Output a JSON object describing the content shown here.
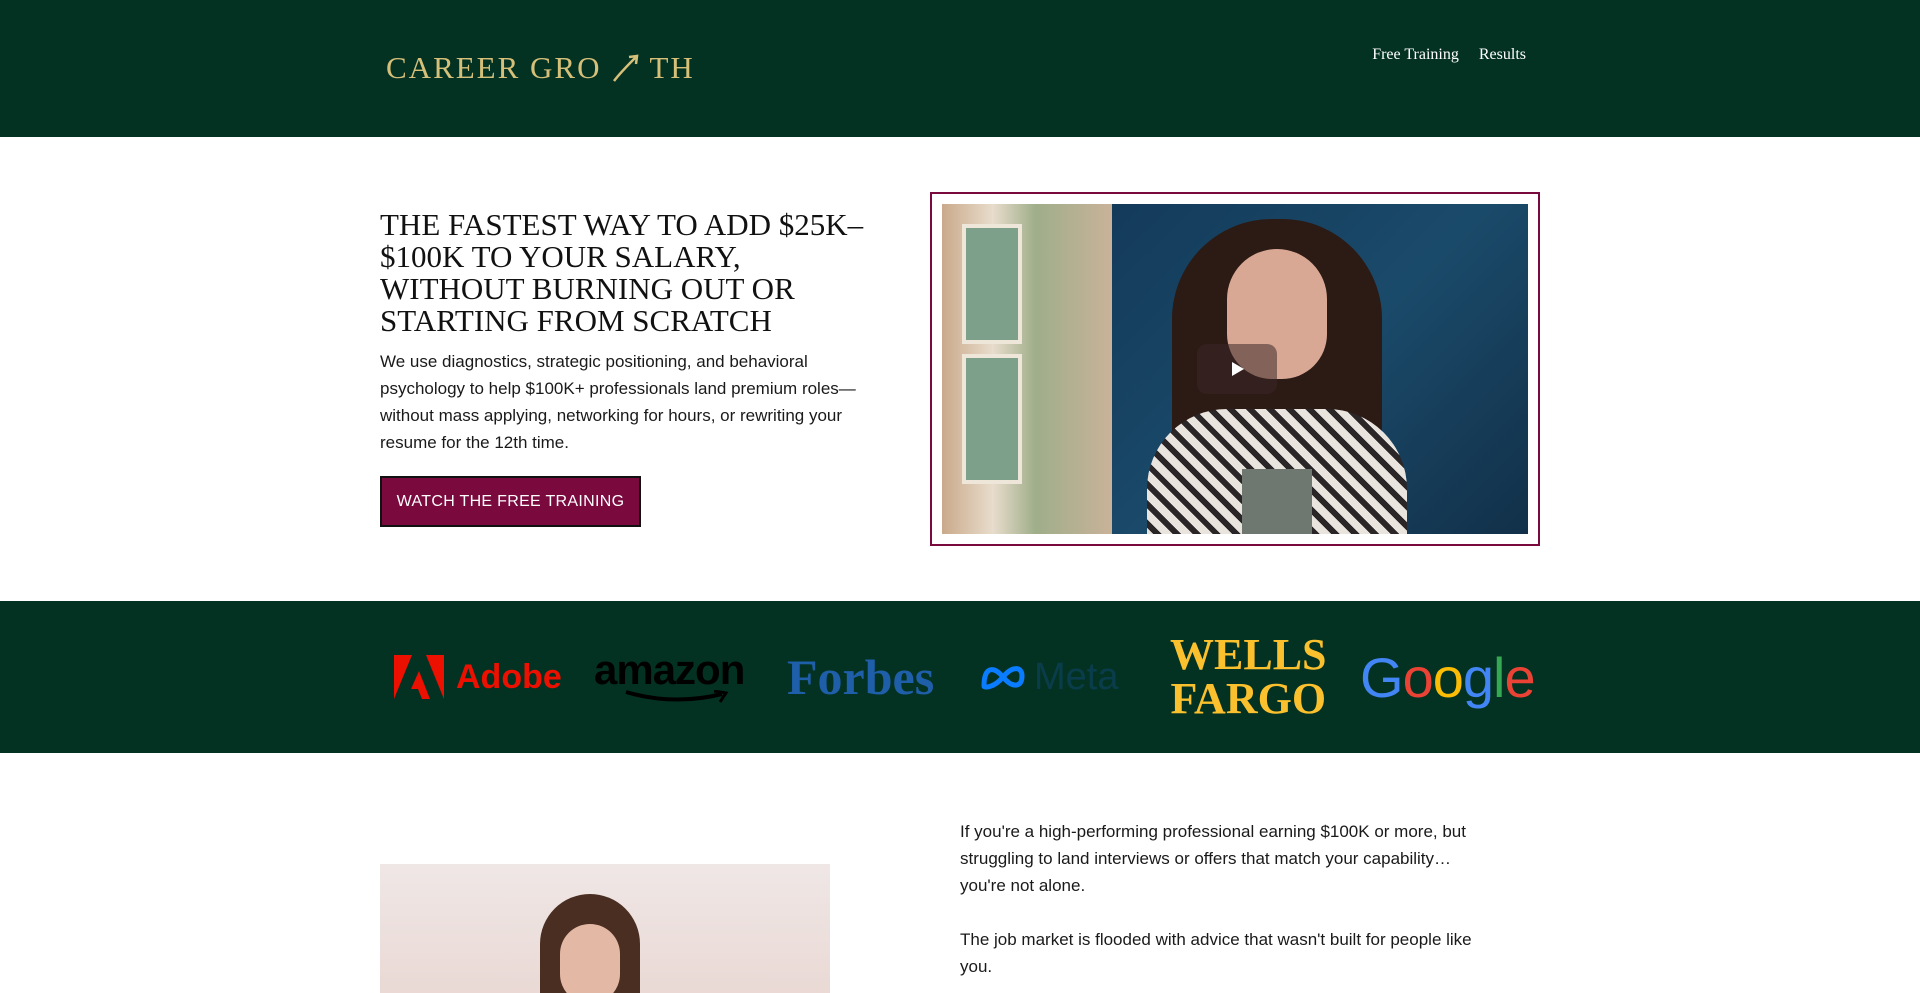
{
  "header": {
    "logo_text": "CAREER GROWTH",
    "logo_part1": "CAREER GRO",
    "logo_part2": "TH",
    "nav": [
      {
        "label": "Free Training"
      },
      {
        "label": "Results"
      }
    ]
  },
  "hero": {
    "title": "THE FASTEST WAY TO ADD $25K–$100K TO YOUR SALARY, WITHOUT BURNING OUT OR STARTING FROM SCRATCH",
    "description": "We use diagnostics, strategic positioning, and behavioral psychology to help $100K+ professionals land premium roles—without mass applying, networking for hours, or rewriting your resume for the 12th time.",
    "cta_label": "WATCH THE FREE TRAINING"
  },
  "logos": [
    {
      "name": "Adobe"
    },
    {
      "name": "amazon"
    },
    {
      "name": "Forbes"
    },
    {
      "name": "Meta"
    },
    {
      "name": "WELLS FARGO",
      "line1": "WELLS",
      "line2": "FARGO"
    },
    {
      "name": "Google"
    }
  ],
  "intro": {
    "paragraphs": [
      "If you're a high-performing professional earning $100K or more, but struggling to land interviews or offers that match your capability… you're not alone.",
      "The job market is flooded with advice that wasn't built for people like you."
    ]
  },
  "colors": {
    "header_bg": "#043222",
    "accent": "#7a0a3e",
    "logo_gold": "#d6c079"
  },
  "icons": {
    "play": "play-icon"
  }
}
